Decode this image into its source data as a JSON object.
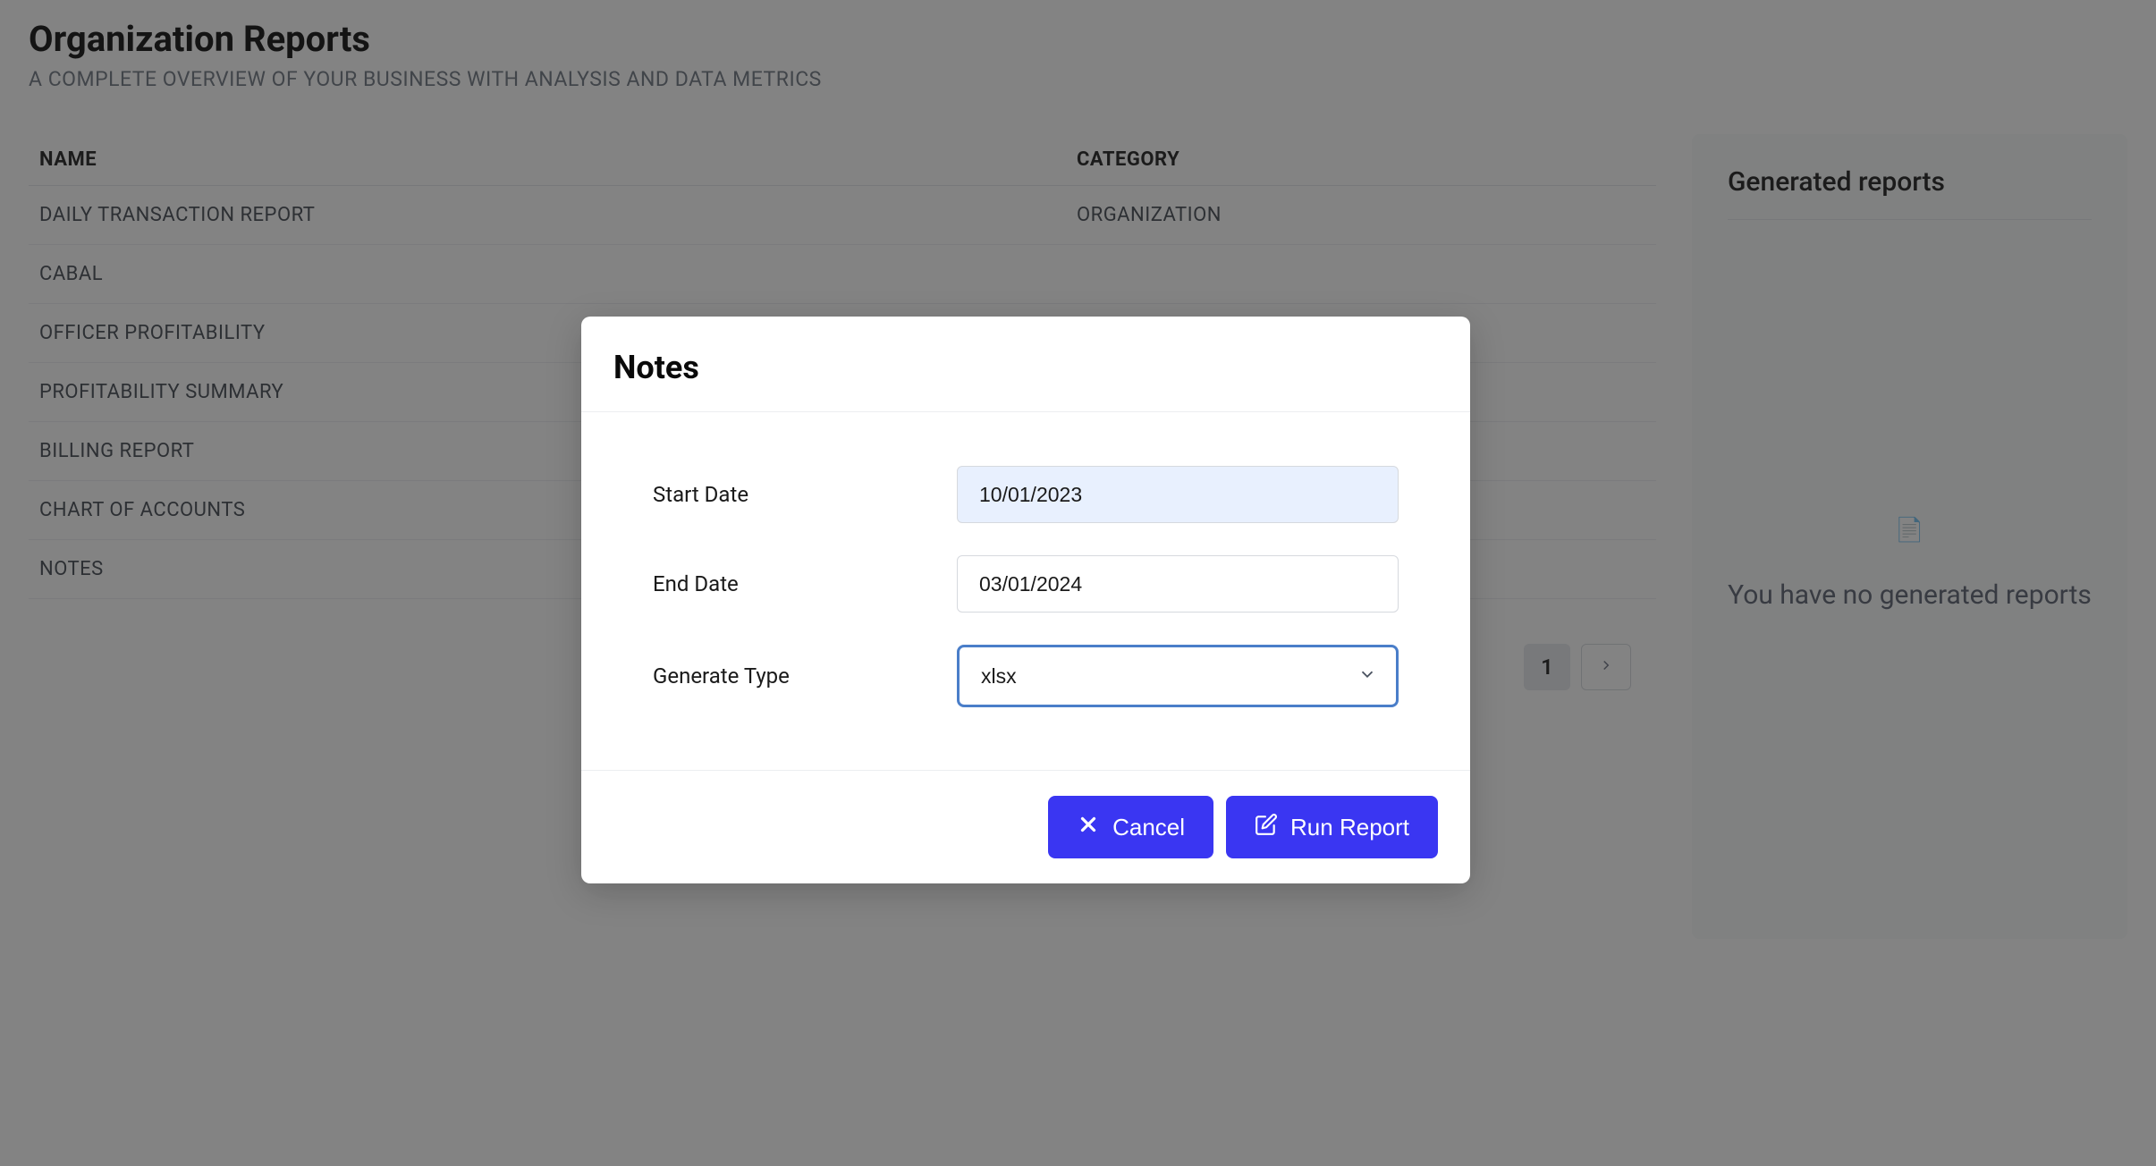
{
  "page": {
    "title": "Organization Reports",
    "subtitle": "A COMPLETE OVERVIEW OF YOUR BUSINESS WITH ANALYSIS AND DATA METRICS"
  },
  "table": {
    "headers": {
      "name": "NAME",
      "category": "CATEGORY"
    },
    "rows": [
      {
        "name": "DAILY TRANSACTION REPORT",
        "category": "ORGANIZATION"
      },
      {
        "name": "CABAL",
        "category": ""
      },
      {
        "name": "OFFICER PROFITABILITY",
        "category": ""
      },
      {
        "name": "PROFITABILITY SUMMARY",
        "category": ""
      },
      {
        "name": "BILLING REPORT",
        "category": ""
      },
      {
        "name": "CHART OF ACCOUNTS",
        "category": ""
      },
      {
        "name": "NOTES",
        "category": ""
      }
    ]
  },
  "pagination": {
    "current": "1"
  },
  "generated": {
    "title": "Generated reports",
    "empty_text": "You have no generated reports",
    "empty_icon": "📄"
  },
  "modal": {
    "title": "Notes",
    "fields": {
      "start_date": {
        "label": "Start Date",
        "value": "10/01/2023"
      },
      "end_date": {
        "label": "End Date",
        "value": "03/01/2024"
      },
      "generate_type": {
        "label": "Generate Type",
        "value": "xlsx"
      }
    },
    "buttons": {
      "cancel": "Cancel",
      "run": "Run Report"
    }
  }
}
